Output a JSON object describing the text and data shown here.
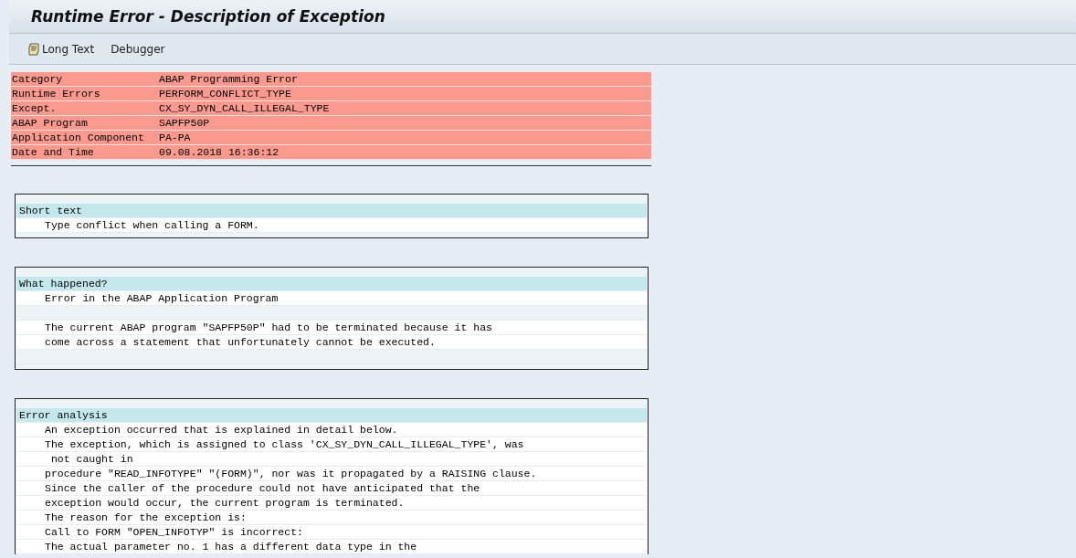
{
  "window": {
    "title": "Runtime Error - Description of Exception"
  },
  "toolbar": [
    {
      "label": "Long Text",
      "kind": "icon"
    },
    {
      "label": "Debugger",
      "kind": "plain"
    }
  ],
  "header_rows": [
    {
      "label": "Category",
      "value": "ABAP Programming Error"
    },
    {
      "label": "Runtime Errors",
      "value": "PERFORM_CONFLICT_TYPE"
    },
    {
      "label": "Except.",
      "value": "CX_SY_DYN_CALL_ILLEGAL_TYPE"
    },
    {
      "label": "ABAP Program",
      "value": "SAPFP50P"
    },
    {
      "label": "Application Component",
      "value": "PA-PA"
    },
    {
      "label": "Date and Time",
      "value": "09.08.2018 16:36:12"
    }
  ],
  "sections": [
    {
      "title": "Short text",
      "lines": [
        {
          "kind": "text",
          "text": "Type conflict when calling a FORM."
        }
      ]
    },
    {
      "title": "What happened?",
      "lines": [
        {
          "kind": "text",
          "text": "Error in the ABAP Application Program"
        },
        {
          "kind": "blank"
        },
        {
          "kind": "text",
          "text": "The current ABAP program \"SAPFP50P\" had to be terminated because it has"
        },
        {
          "kind": "text",
          "text": "come across a statement that unfortunately cannot be executed."
        },
        {
          "kind": "blank"
        }
      ]
    },
    {
      "title": "Error analysis",
      "lines": [
        {
          "kind": "text",
          "text": "An exception occurred that is explained in detail below."
        },
        {
          "kind": "text",
          "text": "The exception, which is assigned to class 'CX_SY_DYN_CALL_ILLEGAL_TYPE', was"
        },
        {
          "kind": "text",
          "text": " not caught in"
        },
        {
          "kind": "text",
          "text": "procedure \"READ_INFOTYPE\" \"(FORM)\", nor was it propagated by a RAISING clause."
        },
        {
          "kind": "text",
          "text": "Since the caller of the procedure could not have anticipated that the"
        },
        {
          "kind": "text",
          "text": "exception would occur, the current program is terminated."
        },
        {
          "kind": "text",
          "text": "The reason for the exception is:"
        },
        {
          "kind": "text",
          "text": "Call to FORM \"OPEN_INFOTYP\" is incorrect:"
        },
        {
          "kind": "text",
          "text": "The actual parameter no. 1 has a different data type in the"
        }
      ]
    }
  ]
}
